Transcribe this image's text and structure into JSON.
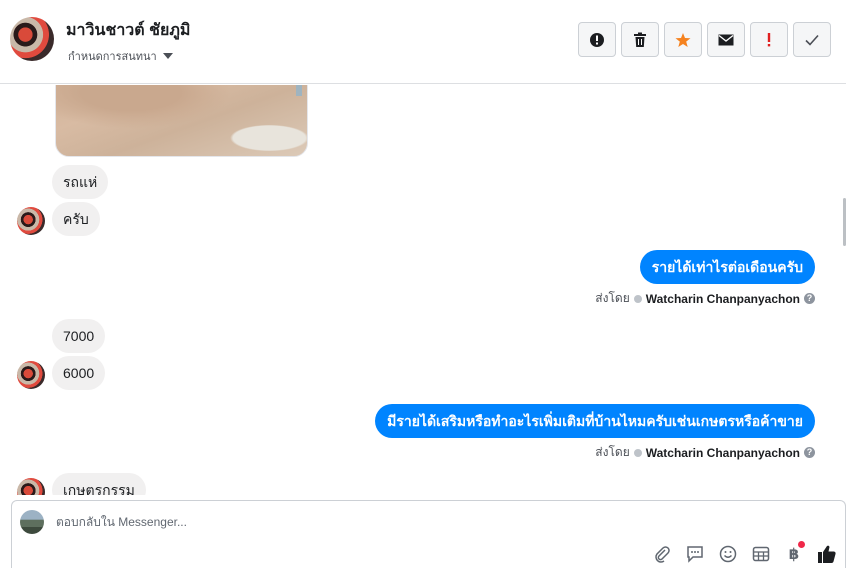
{
  "header": {
    "contact_name": "มาวินชาวต์ ชัยภูมิ",
    "assign_label": "กำหนดการสนทนา"
  },
  "actions": [
    {
      "name": "info-icon"
    },
    {
      "name": "trash-icon"
    },
    {
      "name": "star-icon"
    },
    {
      "name": "envelope-icon"
    },
    {
      "name": "exclamation-icon"
    },
    {
      "name": "check-icon"
    }
  ],
  "messages": {
    "in_1": "รถแห่",
    "in_2": "ครับ",
    "out_1": "รายได้เท่าไรต่อเดือนครับ",
    "sent_by_1_prefix": "ส่งโดย",
    "sent_by_1_name": "Watcharin Chanpanyachon",
    "in_3": "7000",
    "in_4": "6000",
    "out_2": "มีรายได้เสริมหรือทำอะไรเพิ่มเติมที่บ้านไหมครับเช่นเกษตรหรือค้าขาย",
    "sent_by_2_prefix": "ส่งโดย",
    "sent_by_2_name": "Watcharin Chanpanyachon",
    "in_5_partial": "เกษตรกรรม"
  },
  "composer": {
    "placeholder": "ตอบกลับใน Messenger..."
  },
  "tools": [
    "paperclip-icon",
    "chat-bubble-icon",
    "smiley-icon",
    "table-icon",
    "baht-icon",
    "thumbs-up-icon"
  ],
  "colors": {
    "accent": "#0084ff",
    "incoming_bubble": "#f1f0f0",
    "star": "#f5821f",
    "alert": "#e02020",
    "notification": "#f02849"
  }
}
